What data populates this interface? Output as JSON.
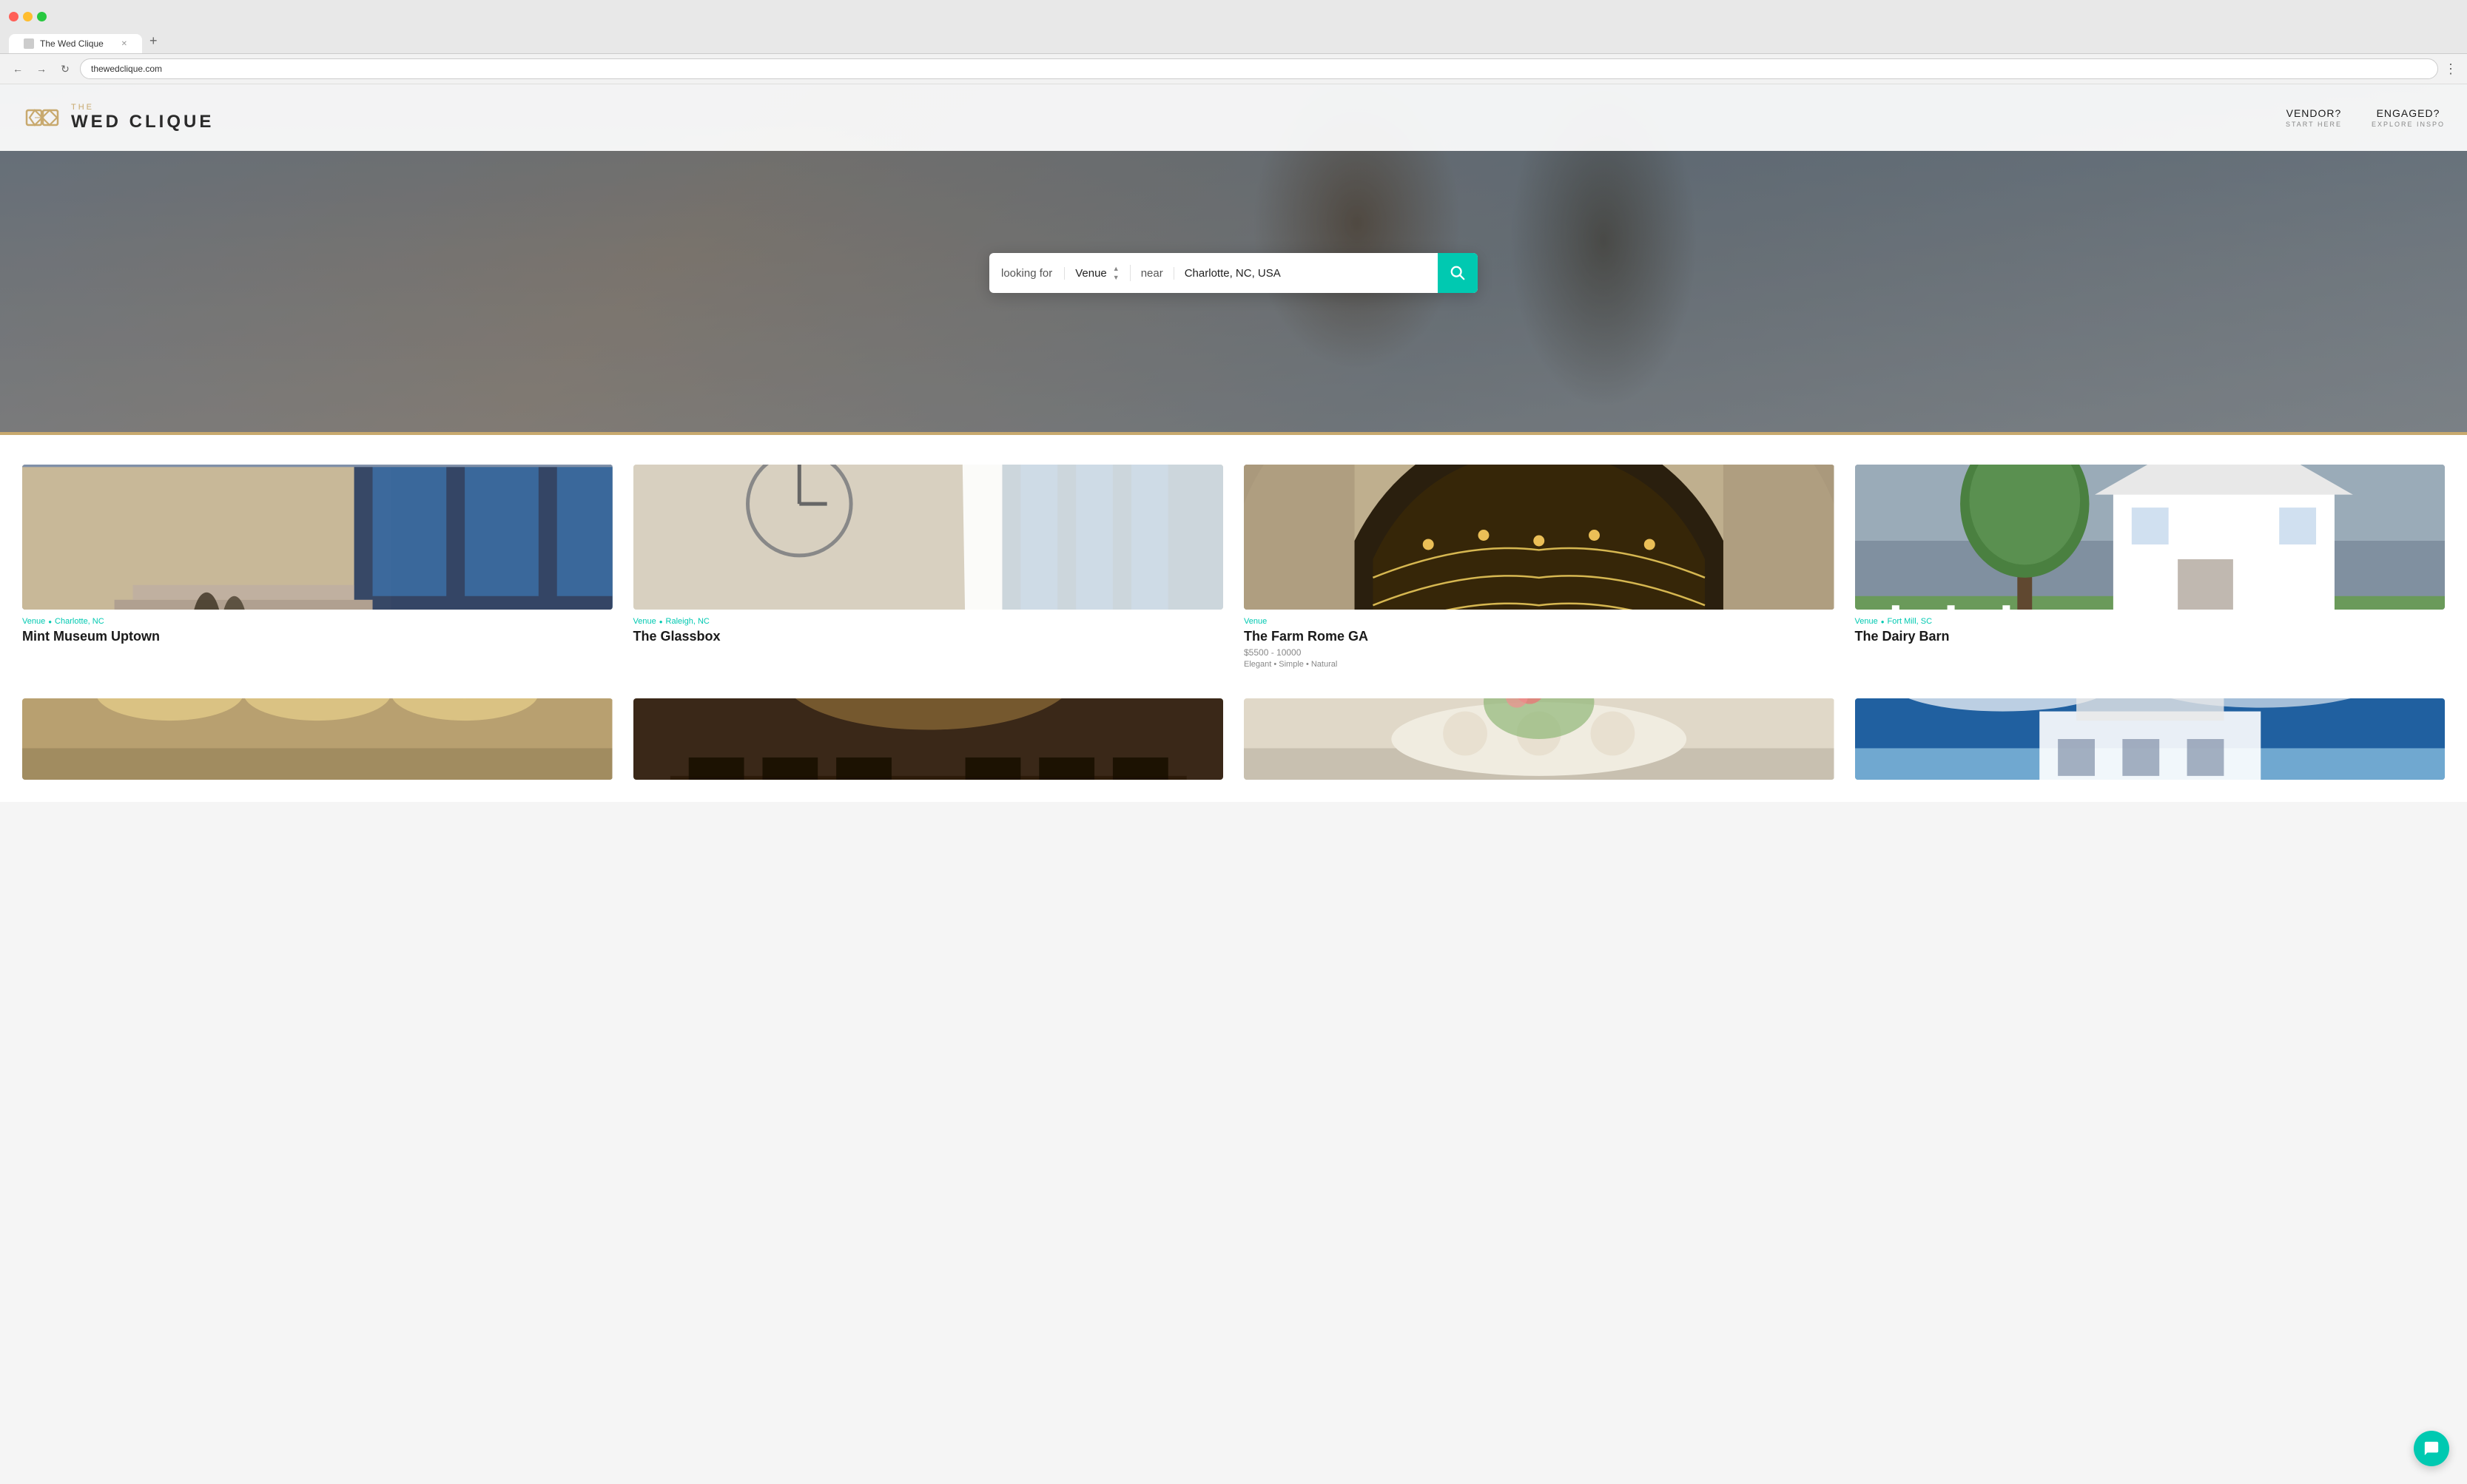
{
  "browser": {
    "tab_title": "The Wed Clique",
    "new_tab_symbol": "+",
    "nav_back": "←",
    "nav_forward": "→",
    "nav_refresh": "↻",
    "address_bar_value": "",
    "more_options": "⋮"
  },
  "header": {
    "logo_the": "THE",
    "logo_wed": "WED CLIQUE",
    "nav": [
      {
        "main": "VENDOR?",
        "sub": "START HERE"
      },
      {
        "main": "ENGAGED?",
        "sub": "EXPLORE INSPO"
      }
    ]
  },
  "search": {
    "label": "looking for",
    "select_value": "Venue",
    "near_label": "near",
    "location_value": "Charlotte, NC, USA"
  },
  "cards": [
    {
      "type": "Venue",
      "location": "Charlotte, NC",
      "title": "Mint Museum Uptown",
      "price": null,
      "tags": null,
      "img_class": "img-mint-museum"
    },
    {
      "type": "Venue",
      "location": "Raleigh, NC",
      "title": "The Glassbox",
      "price": null,
      "tags": null,
      "img_class": "img-glassbox"
    },
    {
      "type": "Venue",
      "location": null,
      "title": "The Farm Rome GA",
      "price": "$5500 - 10000",
      "tags": "Elegant • Simple • Natural",
      "img_class": "img-farm"
    },
    {
      "type": "Venue",
      "location": "Fort Mill, SC",
      "title": "The Dairy Barn",
      "price": null,
      "tags": null,
      "img_class": "img-dairy-barn"
    }
  ],
  "bottom_cards": [
    {
      "img_class": "img-bottom1"
    },
    {
      "img_class": "img-bottom2"
    },
    {
      "img_class": "img-bottom3"
    },
    {
      "img_class": "img-bottom4"
    }
  ],
  "divider_color": "#c8a96e",
  "accent_color": "#00c9b1"
}
